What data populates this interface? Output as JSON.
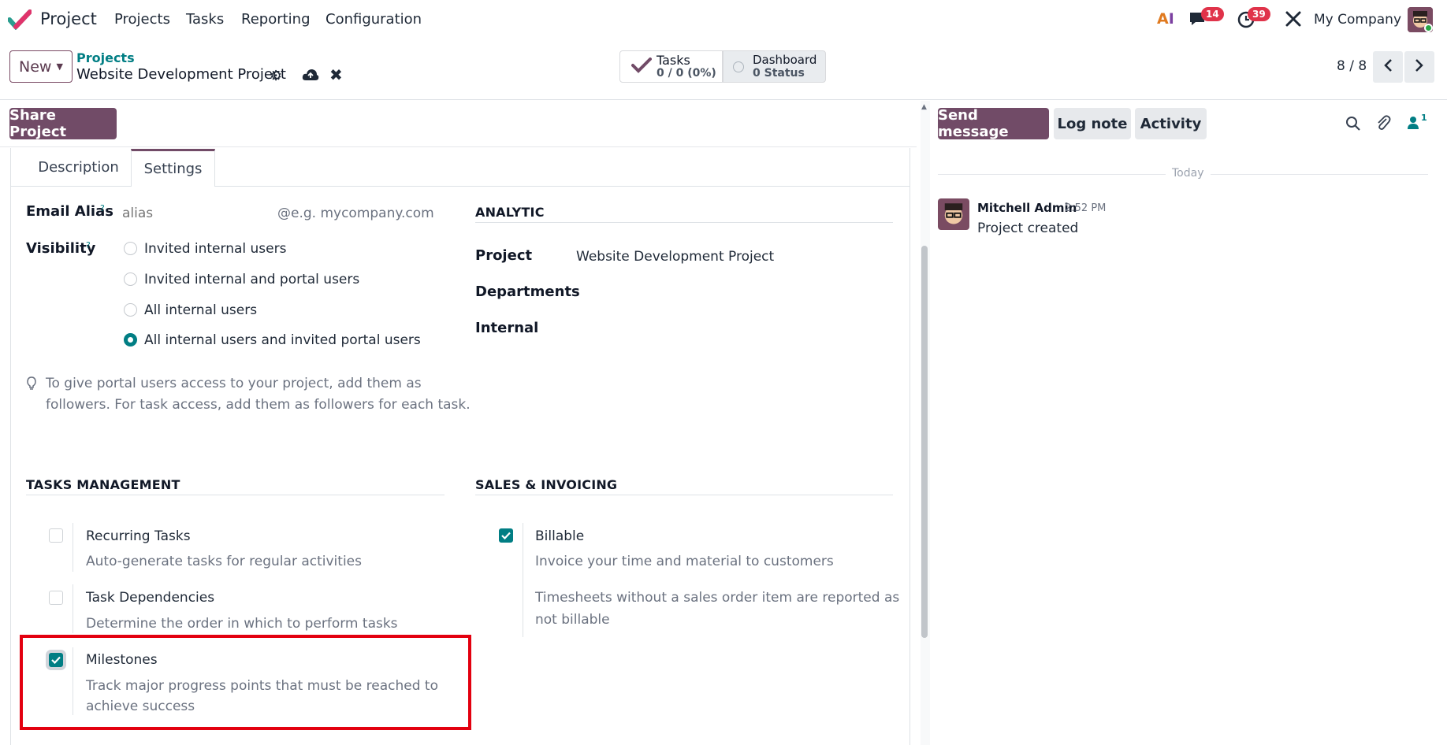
{
  "navbar": {
    "app_name": "Project",
    "menu": [
      "Projects",
      "Tasks",
      "Reporting",
      "Configuration"
    ],
    "messages_count": "14",
    "activities_count": "39",
    "company": "My Company"
  },
  "control": {
    "new_label": "New",
    "breadcrumb_parent": "Projects",
    "record_name": "Website Development Project",
    "tasks_label": "Tasks",
    "tasks_value": "0 / 0 (0%)",
    "dashboard_label": "Dashboard",
    "dashboard_value": "0 Status",
    "pager": "8 / 8"
  },
  "form": {
    "share_label": "Share Project",
    "tabs": [
      "Description",
      "Settings"
    ],
    "email_alias_label": "Email Alias",
    "email_alias_placeholder": "alias",
    "email_domain_placeholder": "@e.g. mycompany.com",
    "visibility_label": "Visibility",
    "help_mark": "?",
    "visibility_options": [
      "Invited internal users",
      "Invited internal and portal users",
      "All internal users",
      "All internal users and invited portal users"
    ],
    "visibility_selected": 3,
    "hint_line1": "To give portal users access to your project, add them as",
    "hint_line2": "followers. For task access, add them as followers for each task.",
    "analytic_title": "ANALYTIC",
    "project_label": "Project",
    "project_value": "Website Development Project",
    "departments_label": "Departments",
    "internal_label": "Internal",
    "tasks_mgmt_title": "TASKS MANAGEMENT",
    "recurring_label": "Recurring Tasks",
    "recurring_desc": "Auto-generate tasks for regular activities",
    "dependencies_label": "Task Dependencies",
    "dependencies_desc": "Determine the order in which to perform tasks",
    "milestones_label": "Milestones",
    "milestones_desc1": "Track major progress points that must be reached to",
    "milestones_desc2": "achieve success",
    "sales_title": "SALES & INVOICING",
    "billable_label": "Billable",
    "billable_desc": "Invoice your time and material to customers",
    "billable_note1": "Timesheets without a sales order item are reported as",
    "billable_note2": "not billable"
  },
  "chatter": {
    "send_message": "Send message",
    "log_note": "Log note",
    "activity": "Activity",
    "followers_count": "1",
    "date_separator": "Today",
    "author": "Mitchell Admin",
    "time": "2:52 PM",
    "body": "Project created"
  },
  "colors": {
    "brand": "#714B67",
    "teal": "#017e84",
    "highlight": "#e3000f"
  }
}
